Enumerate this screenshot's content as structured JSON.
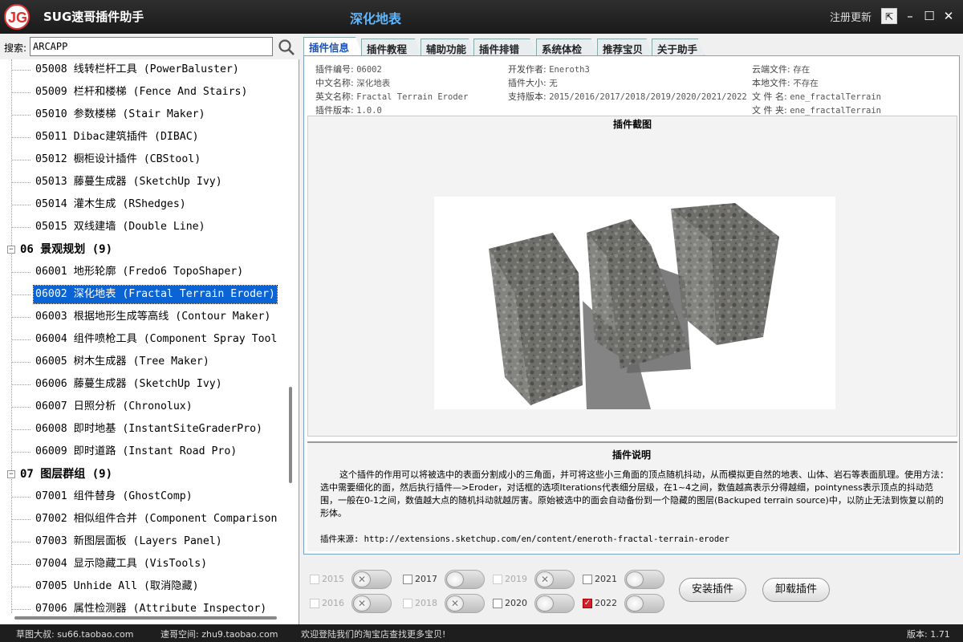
{
  "titlebar": {
    "app_name": "SUG速哥插件助手",
    "window_title": "深化地表",
    "register_link": "注册更新"
  },
  "search": {
    "label": "搜索:",
    "value": "ARCAPP"
  },
  "tree": {
    "items_top": [
      "05008 线转栏杆工具 (PowerBaluster)",
      "05009 栏杆和楼梯 (Fence And Stairs)",
      "05010 参数楼梯 (Stair Maker)",
      "05011 Dibac建筑插件 (DIBAC)",
      "05012 橱柜设计插件 (CBStool)",
      "05013 藤蔓生成器 (SketchUp Ivy)",
      "05014 灌木生成 (RShedges)",
      "05015 双线建墙 (Double Line)"
    ],
    "cat06": "06 景观规划 (9)",
    "items06": [
      "06001 地形轮廓 (Fredo6 TopoShaper)",
      "06002 深化地表 (Fractal Terrain Eroder)",
      "06003 根据地形生成等高线 (Contour Maker)",
      "06004 组件喷枪工具 (Component Spray Tool",
      "06005 树木生成器 (Tree Maker)",
      "06006 藤蔓生成器 (SketchUp Ivy)",
      "06007 日照分析 (Chronolux)",
      "06008 即时地基 (InstantSiteGraderPro)",
      "06009 即时道路 (Instant Road Pro)"
    ],
    "cat07": "07 图层群组 (9)",
    "items07": [
      "07001 组件替身 (GhostComp)",
      "07002 相似组件合并 (Component Comparison",
      "07003 新图层面板 (Layers Panel)",
      "07004 显示隐藏工具 (VisTools)",
      "07005 Unhide All (取消隐藏)",
      "07006 属性检测器 (Attribute Inspector)"
    ]
  },
  "tabs": [
    "插件信息",
    "插件教程",
    "辅助功能",
    "插件排错",
    "系统体检",
    "推荐宝贝",
    "关于助手"
  ],
  "info": {
    "k_num": "插件编号:",
    "v_num": "06002",
    "k_cn": "中文名称:",
    "v_cn": "深化地表",
    "k_en": "英文名称:",
    "v_en": "Fractal Terrain Eroder",
    "k_ver": "插件版本:",
    "v_ver": "1.0.0",
    "k_dev": "开发作者:",
    "v_dev": "Eneroth3",
    "k_size": "插件大小:",
    "v_size": "无",
    "k_sup": "支持版本:",
    "v_sup": "2015/2016/2017/2018/2019/2020/2021/2022",
    "k_cloud": "云端文件:",
    "v_cloud": "存在",
    "k_local": "本地文件:",
    "v_local": "不存在",
    "k_fname": "文 件 名:",
    "v_fname": "ene_fractalTerrain",
    "k_folder": "文 件 夹:",
    "v_folder": "ene_fractalTerrain"
  },
  "screenshot_title": "插件截图",
  "desc_title": "插件说明",
  "desc_text": "这个插件的作用可以将被选中的表面分割成小的三角面，并可将这些小三角面的顶点随机抖动，从而模拟更自然的地表、山体、岩石等表面肌理。使用方法：选中需要细化的面，然后执行插件—>Eroder，对话框的选项Iterations代表细分层级，在1~4之间，数值越高表示分得越细，pointyness表示顶点的抖动范围，一般在0-1之间，数值越大点的随机抖动就越厉害。原始被选中的面会自动备份到一个隐藏的图层(Backuped terrain source)中，以防止无法到恢复以前的形体。",
  "desc_source": "插件来源: http://extensions.sketchup.com/en/content/eneroth-fractal-terrain-eroder",
  "versions": [
    {
      "year": "2015",
      "enabled": false,
      "checked": false,
      "on": false
    },
    {
      "year": "2016",
      "enabled": false,
      "checked": false,
      "on": false
    },
    {
      "year": "2017",
      "enabled": true,
      "checked": false,
      "on": true
    },
    {
      "year": "2018",
      "enabled": false,
      "checked": false,
      "on": false
    },
    {
      "year": "2019",
      "enabled": false,
      "checked": false,
      "on": false
    },
    {
      "year": "2020",
      "enabled": true,
      "checked": false,
      "on": true
    },
    {
      "year": "2021",
      "enabled": true,
      "checked": false,
      "on": true
    },
    {
      "year": "2022",
      "enabled": true,
      "checked": true,
      "on": true
    }
  ],
  "buttons": {
    "install": "安装插件",
    "uninstall": "卸载插件"
  },
  "status": {
    "s1": "草图大叔: su66.taobao.com",
    "s2": "速哥空间: zhu9.taobao.com",
    "s3": "欢迎登陆我们的淘宝店查找更多宝贝!",
    "s4": "版本: 1.71"
  },
  "colors": {
    "accent": "#0a64d6",
    "title_blue": "#5eb6ff",
    "check_red": "#d4202a"
  }
}
